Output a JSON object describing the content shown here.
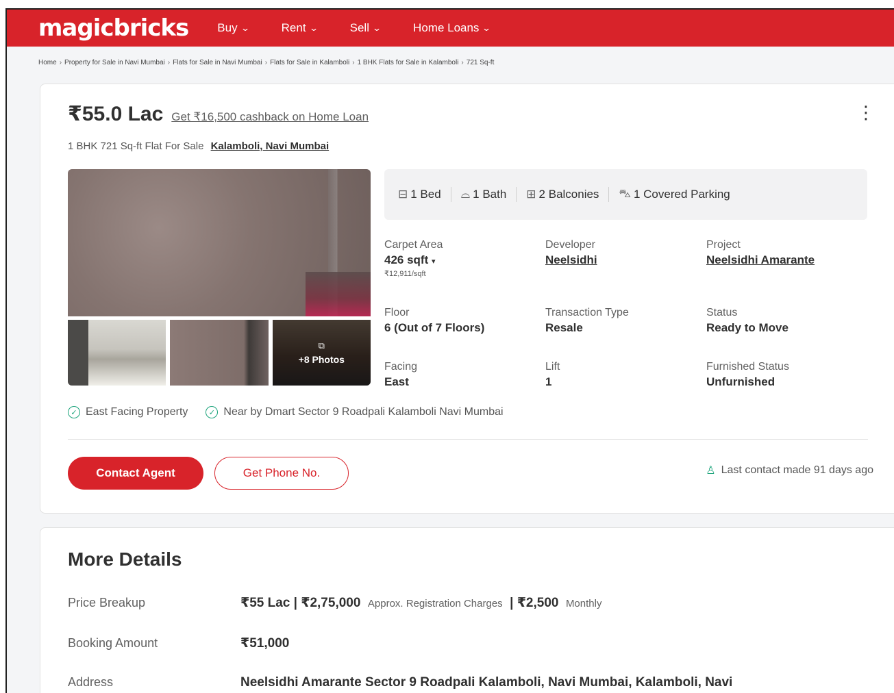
{
  "header": {
    "logo": "magicbricks",
    "nav": [
      {
        "label": "Buy"
      },
      {
        "label": "Rent"
      },
      {
        "label": "Sell"
      },
      {
        "label": "Home Loans"
      }
    ]
  },
  "breadcrumb": [
    "Home",
    "Property for Sale in Navi Mumbai",
    "Flats for Sale in Navi Mumbai",
    "Flats for Sale in Kalamboli",
    "1 BHK Flats for Sale in Kalamboli",
    "721 Sq-ft"
  ],
  "listing": {
    "price": "₹55.0 Lac",
    "cashback": "Get ₹16,500 cashback on Home Loan",
    "subtitle": "1 BHK 721 Sq-ft Flat For Sale",
    "location": "Kalamboli, Navi Mumbai",
    "more_photos": "+8 Photos",
    "amenities": [
      {
        "icon": "bed-icon",
        "label": "1 Bed"
      },
      {
        "icon": "bath-icon",
        "label": "1 Bath"
      },
      {
        "icon": "balcony-icon",
        "label": "2 Balconies"
      },
      {
        "icon": "parking-icon",
        "label": "1 Covered Parking"
      }
    ],
    "specs": {
      "carpet_area": {
        "label": "Carpet Area",
        "value": "426 sqft",
        "sub": "₹12,911/sqft"
      },
      "developer": {
        "label": "Developer",
        "value": "Neelsidhi"
      },
      "project": {
        "label": "Project",
        "value": "Neelsidhi Amarante"
      },
      "floor": {
        "label": "Floor",
        "value": "6 (Out of 7 Floors)"
      },
      "transaction": {
        "label": "Transaction Type",
        "value": "Resale"
      },
      "status": {
        "label": "Status",
        "value": "Ready to Move"
      },
      "facing": {
        "label": "Facing",
        "value": "East"
      },
      "lift": {
        "label": "Lift",
        "value": "1"
      },
      "furnished": {
        "label": "Furnished Status",
        "value": "Unfurnished"
      }
    },
    "highlights": [
      "East Facing Property",
      "Near by Dmart Sector 9 Roadpali Kalamboli Navi Mumbai"
    ],
    "contact_button": "Contact Agent",
    "phone_button": "Get Phone No.",
    "last_contact": "Last contact made 91 days ago"
  },
  "more_details": {
    "title": "More Details",
    "price_breakup": {
      "label": "Price Breakup",
      "price": "₹55 Lac | ₹2,75,000",
      "reg_note": "Approx. Registration Charges",
      "monthly": "| ₹2,500",
      "monthly_note": "Monthly"
    },
    "booking": {
      "label": "Booking Amount",
      "value": "₹51,000"
    },
    "address": {
      "label": "Address",
      "value": "Neelsidhi Amarante Sector 9 Roadpali Kalamboli, Navi Mumbai, Kalamboli, Navi"
    }
  },
  "colors": {
    "brand": "#d8232a",
    "accent_green": "#1aa37a"
  }
}
